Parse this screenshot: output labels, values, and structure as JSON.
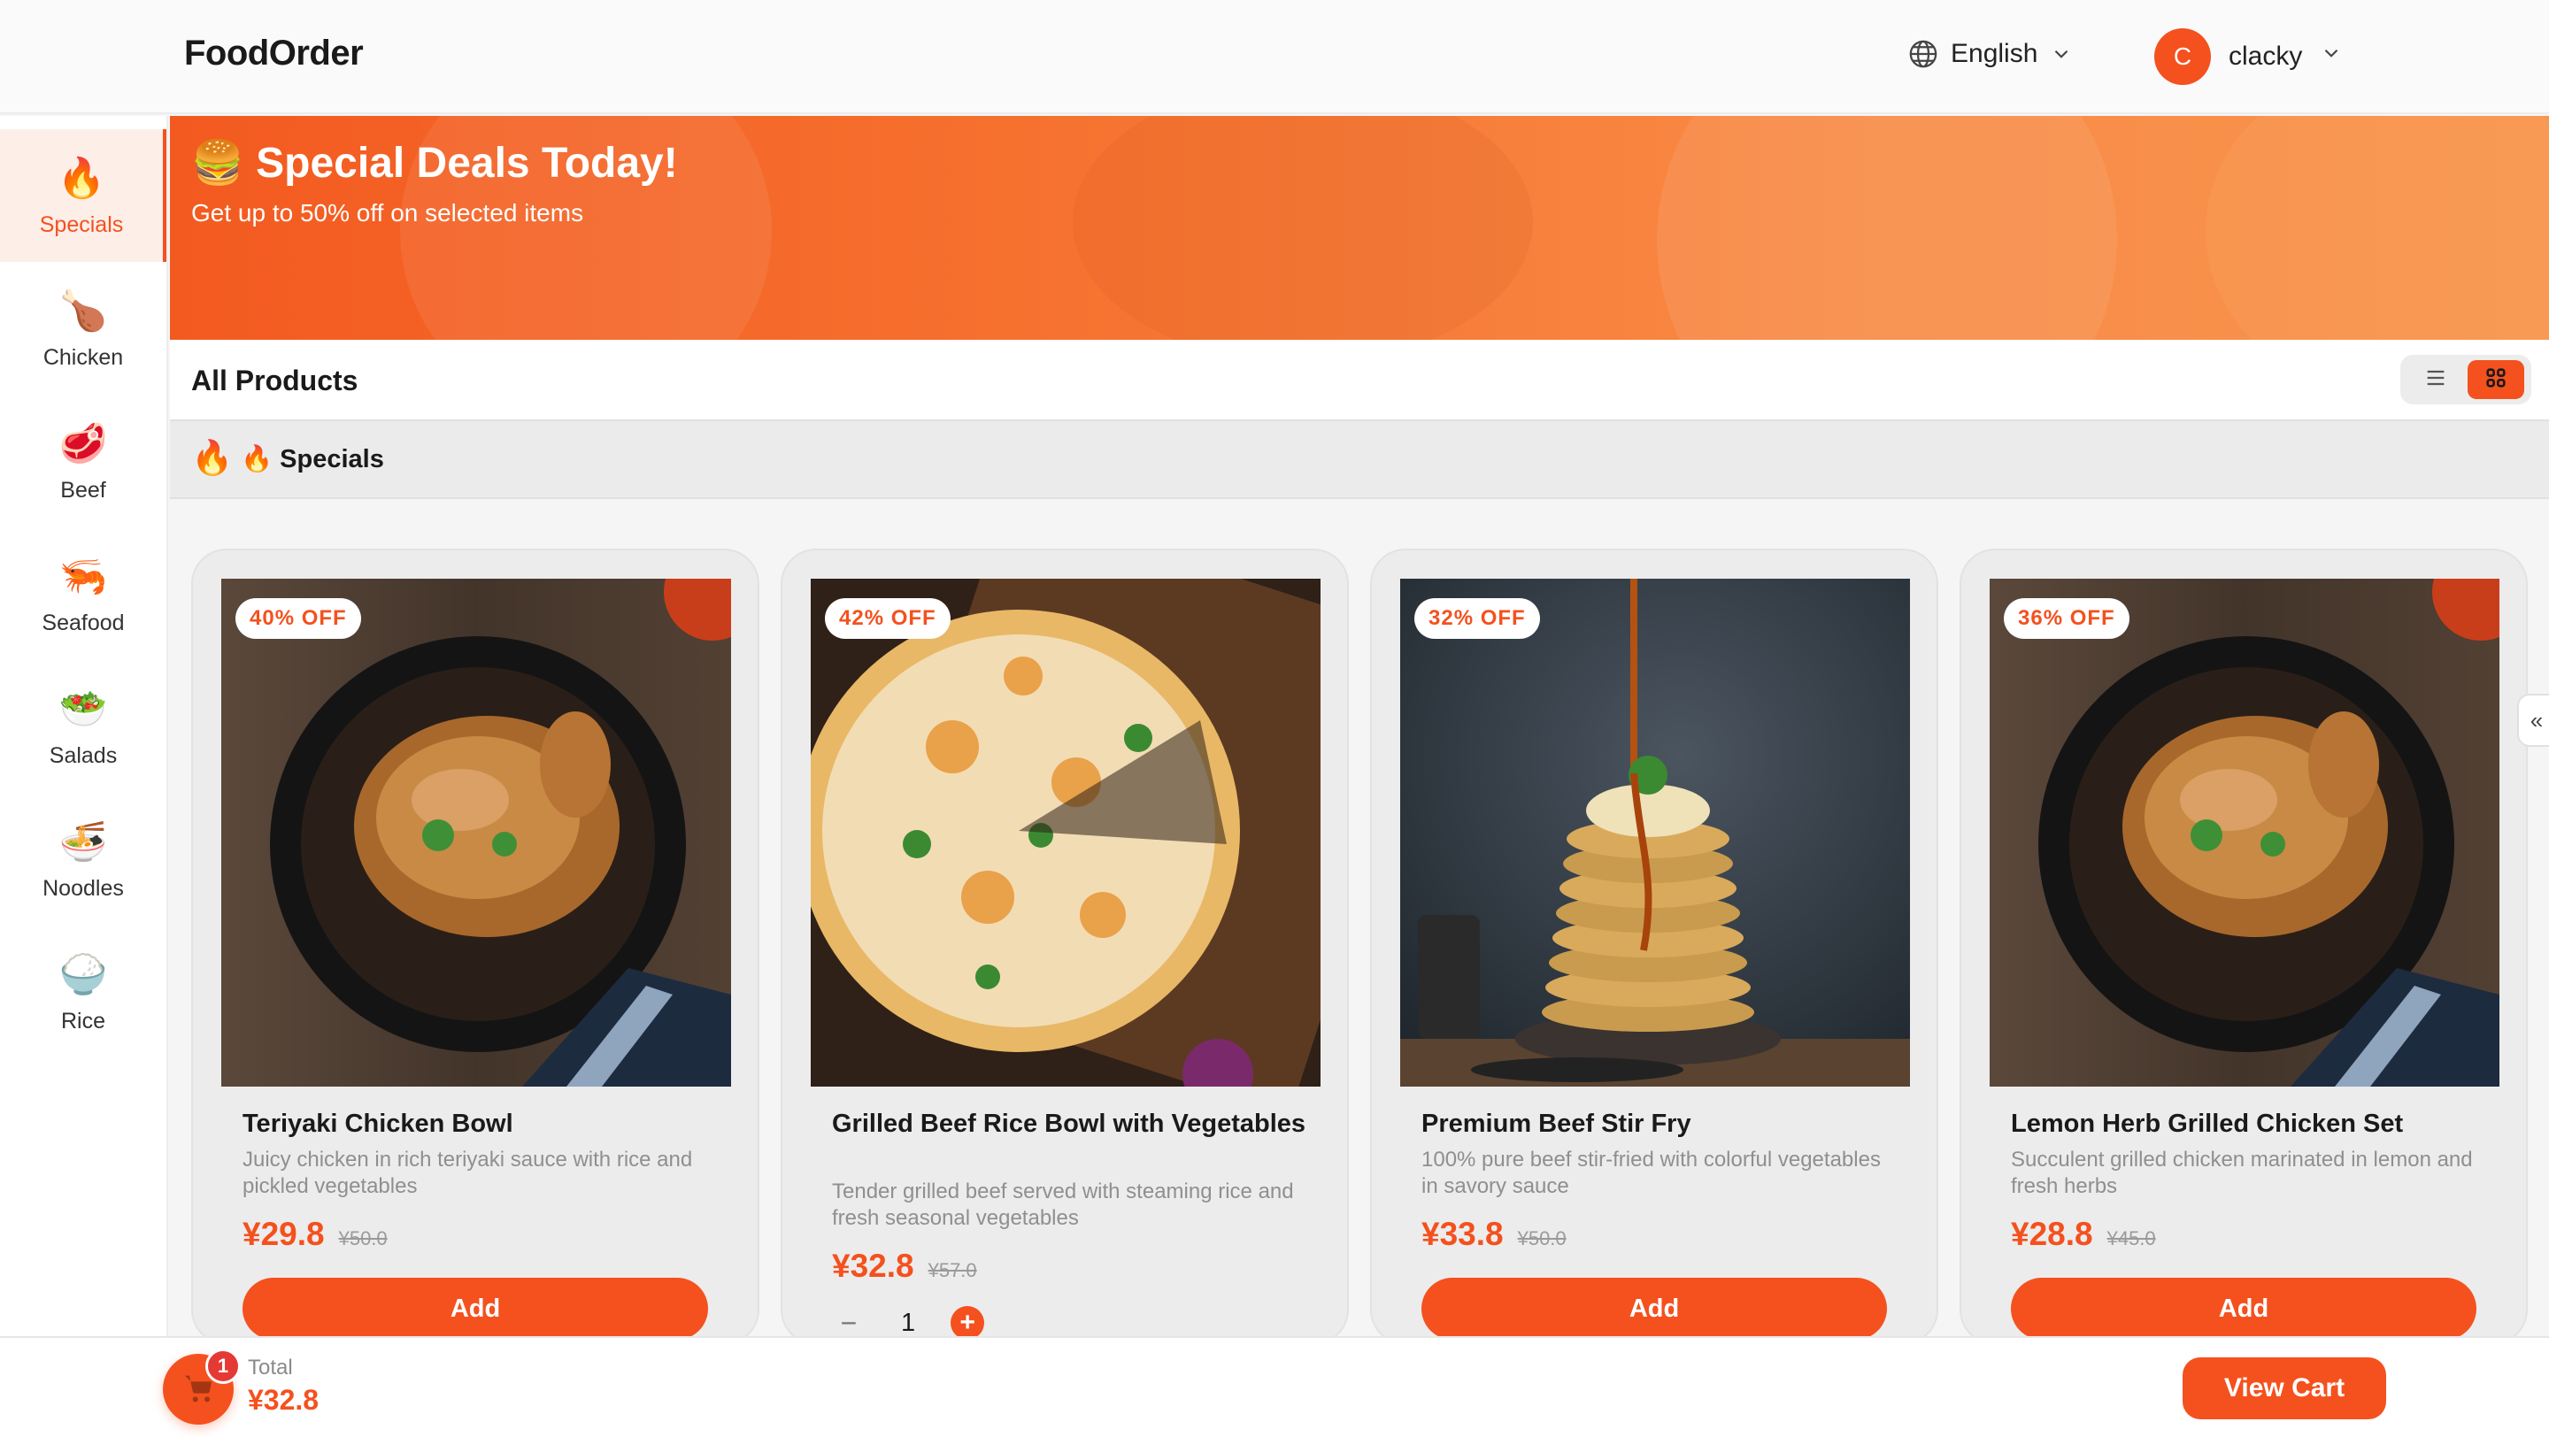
{
  "colors": {
    "accent": "#f4511e",
    "badge": "#e53935"
  },
  "header": {
    "logo": "FoodOrder",
    "language": {
      "icon": "globe-icon",
      "label": "English"
    },
    "user": {
      "initial": "C",
      "name": "clacky"
    }
  },
  "sidebar": {
    "items": [
      {
        "emoji": "🔥",
        "label": "Specials",
        "active": true
      },
      {
        "emoji": "🍗",
        "label": "Chicken"
      },
      {
        "emoji": "🥩",
        "label": "Beef"
      },
      {
        "emoji": "🦐",
        "label": "Seafood"
      },
      {
        "emoji": "🥗",
        "label": "Salads"
      },
      {
        "emoji": "🍜",
        "label": "Noodles"
      },
      {
        "emoji": "🍚",
        "label": "Rice"
      }
    ]
  },
  "banner": {
    "title": "🍔 Special Deals Today!",
    "subtitle": "Get up to 50% off on selected items"
  },
  "products": {
    "title": "All Products",
    "view_mode": "grid",
    "section_icon": "🔥",
    "section_title": "🔥 Specials"
  },
  "cards": [
    {
      "discount": "40% OFF",
      "name": "Teriyaki Chicken Bowl",
      "description": "Juicy chicken in rich teriyaki sauce with rice and pickled vegetables",
      "price": "¥29.8",
      "old_price": "¥50.0",
      "button": "Add",
      "image": "roast-chicken"
    },
    {
      "discount": "42% OFF",
      "name": "Grilled Beef Rice Bowl with Vegetables",
      "description": "Tender grilled beef served with steaming rice and fresh seasonal vegetables",
      "price": "¥32.8",
      "old_price": "¥57.0",
      "quantity": "1",
      "image": "pizza"
    },
    {
      "discount": "32% OFF",
      "name": "Premium Beef Stir Fry",
      "description": "100% pure beef stir-fried with colorful vegetables in savory sauce",
      "price": "¥33.8",
      "old_price": "¥50.0",
      "button": "Add",
      "image": "pancakes"
    },
    {
      "discount": "36% OFF",
      "name": "Lemon Herb Grilled Chicken Set",
      "description": "Succulent grilled chicken marinated in lemon and fresh herbs",
      "price": "¥28.8",
      "old_price": "¥45.0",
      "button": "Add",
      "image": "roast-chicken"
    }
  ],
  "footer": {
    "cart_count": "1",
    "total_label": "Total",
    "total_value": "¥32.8",
    "view_cart": "View Cart"
  },
  "collapse_tab": "«"
}
